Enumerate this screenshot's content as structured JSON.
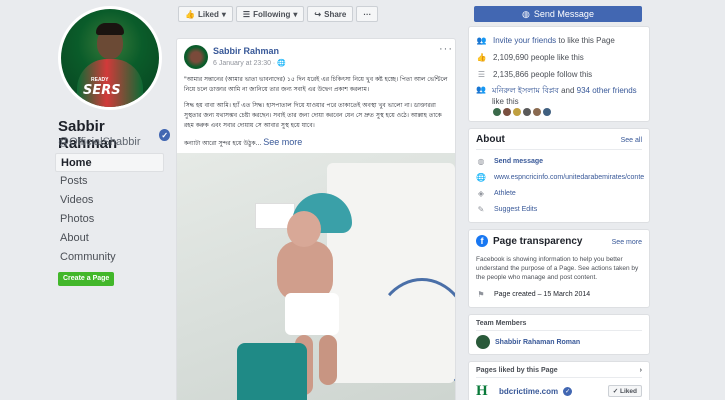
{
  "profile": {
    "name": "Sabbir Rahman",
    "handle": "@OfficialShabbir",
    "jersey_text": "SERS",
    "jersey_small": "READY"
  },
  "nav": {
    "items": [
      {
        "label": "Home"
      },
      {
        "label": "Posts"
      },
      {
        "label": "Videos"
      },
      {
        "label": "Photos"
      },
      {
        "label": "About"
      },
      {
        "label": "Community"
      }
    ],
    "create_page": "Create a Page"
  },
  "toolbar": {
    "liked": "Liked",
    "following": "Following",
    "share": "Share",
    "more": "···",
    "send_message": "Send Message"
  },
  "post": {
    "author": "Sabbir Rahman",
    "time": "6 January at 23:30 · ",
    "menu": "···",
    "para1": "\"আমার সন্তানের (আমার ভাতা ভাবনাদের) ১৫ দিন ধরেই এর চিকিৎসা নিয়ে খুব কষ্ট হচ্ছে। পিতা আল ভেন্টিলে নিয়ে চলে ডাক্তার আমি না জানিয়ে তার জন্য সবাই এর উদ্বেগ প্রকাশ করলাম।",
    "para2": "সিদ্ধ হয় বাবা আমি। হ্যাঁ এত সিদ্ধ। হাসপাতাল দিয়ে যাওয়ার পরে তাকাতেই অবস্থা খুব ভালো না। ডাক্তাররা সুস্থতার জন্য যথাসম্ভব চেষ্টা করছেন। সবাই তার জন্য দোয়া করবেন যেন সে দ্রুত সুস্থ হয়ে ওঠে। আল্লাহ তাকে রহম করুক এবং সবার দোয়ায় সে আবার সুস্থ হয়ে যাবে।",
    "para3": "কন্যাটা আরো সুন্দর হয়ে উঠুক...",
    "see_more": "See more"
  },
  "community": {
    "invite": "Invite your friends",
    "invite_suffix": " to like this Page",
    "likes": "2,109,690 people like this",
    "follows": "2,135,866 people follow this",
    "friend_name": "মনিরুল ইসলাম বিপ্লব",
    "friend_and": " and ",
    "friend_others": "934 other friends",
    "friend_suffix": " like this"
  },
  "about": {
    "title": "About",
    "see_all": "See all",
    "send_message": "Send message",
    "website": "www.espncricinfo.com/unitedarabemirates/conte",
    "category": "Athlete",
    "suggest": "Suggest Edits"
  },
  "transparency": {
    "title": "Page transparency",
    "see_more": "See more",
    "desc": "Facebook is showing information to help you better understand the purpose of a Page. See actions taken by the people who manage and post content.",
    "created": "Page created – 15 March 2014"
  },
  "team": {
    "title": "Team Members",
    "member": "Shabbir Rahaman Roman"
  },
  "liked_pages": {
    "title": "Pages liked by this Page",
    "page_name": "bdcrictime.com",
    "liked_btn": "Liked"
  },
  "colors": {
    "fb_blue": "#4267b2",
    "link": "#385898",
    "green": "#42b72a"
  }
}
